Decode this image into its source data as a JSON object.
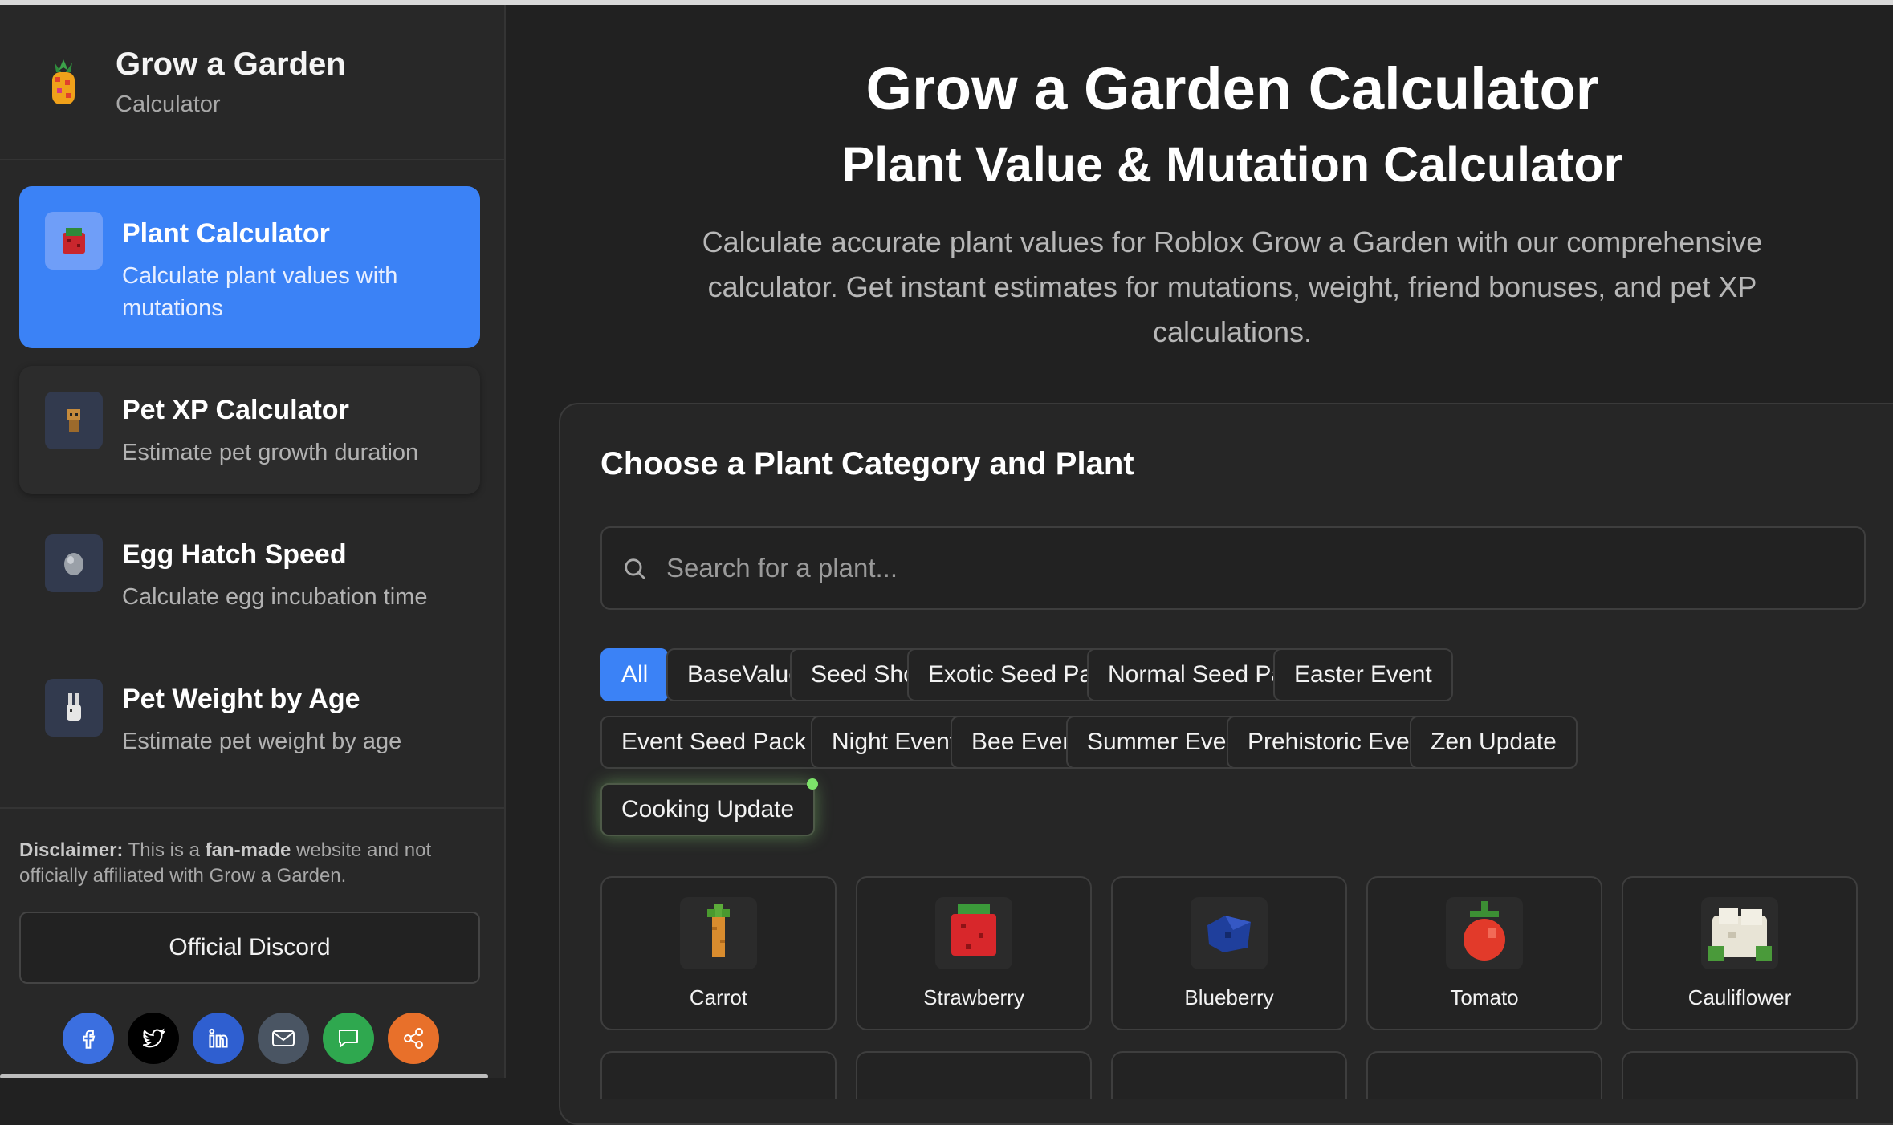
{
  "brand": {
    "title": "Grow a Garden",
    "subtitle": "Calculator",
    "icon": "pineapple-icon"
  },
  "nav": [
    {
      "title": "Plant Calculator",
      "desc": "Calculate plant values with mutations",
      "icon": "strawberry-block-icon",
      "active": true
    },
    {
      "title": "Pet XP Calculator",
      "desc": "Estimate pet growth duration",
      "icon": "pet-icon",
      "active": false
    },
    {
      "title": "Egg Hatch Speed",
      "desc": "Calculate egg incubation time",
      "icon": "egg-icon",
      "active": false
    },
    {
      "title": "Pet Weight by Age",
      "desc": "Estimate pet weight by age",
      "icon": "bunny-icon",
      "active": false
    }
  ],
  "footer": {
    "disclaimer_label": "Disclaimer:",
    "disclaimer_pre": " This is a ",
    "disclaimer_bold": "fan-made",
    "disclaimer_post": " website and not officially affiliated with Grow a Garden.",
    "discord_label": "Official Discord",
    "socials": [
      {
        "name": "facebook",
        "color": "#3b6fe0"
      },
      {
        "name": "twitter",
        "color": "#000000"
      },
      {
        "name": "linkedin",
        "color": "#2f5fd0"
      },
      {
        "name": "email",
        "color": "#4a5563"
      },
      {
        "name": "sms",
        "color": "#2fa84f"
      },
      {
        "name": "share",
        "color": "#e8702a"
      }
    ]
  },
  "hero": {
    "title": "Grow a Garden Calculator",
    "subtitle": "Plant Value & Mutation Calculator",
    "lead": "Calculate accurate plant values for Roblox Grow a Garden with our comprehensive calculator. Get instant estimates for mutations, weight, friend bonuses, and pet XP calculations."
  },
  "panel": {
    "title": "Choose a Plant Category and Plant",
    "search_placeholder": "Search for a plant...",
    "categories": [
      "All",
      "BaseValue",
      "Seed Shop",
      "Exotic Seed Pack",
      "Normal Seed Pack",
      "Easter Event",
      "Event Seed Pack",
      "Night Event",
      "Bee Event",
      "Summer Event",
      "Prehistoric Event",
      "Zen Update",
      "Cooking Update"
    ],
    "active_category": "All",
    "plants": [
      "Carrot",
      "Strawberry",
      "Blueberry",
      "Tomato",
      "Cauliflower"
    ]
  },
  "colors": {
    "accent": "#3b82f6",
    "background": "#212121",
    "sidebar": "#282828"
  }
}
